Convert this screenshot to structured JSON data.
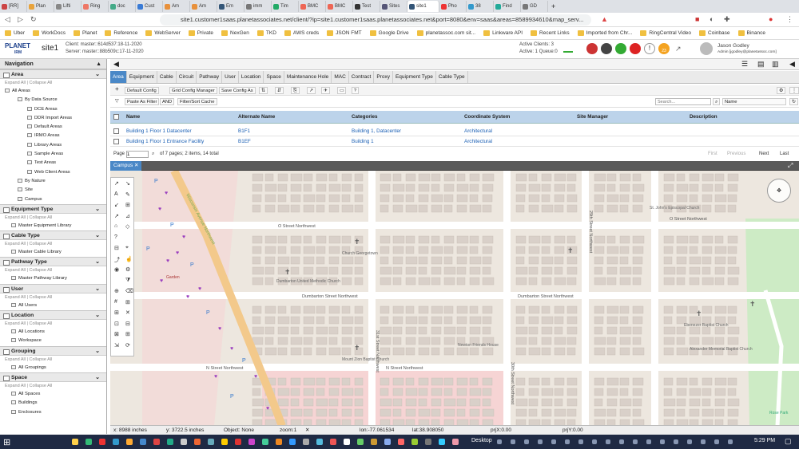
{
  "browser": {
    "tabs": [
      "[RR]",
      "Plan",
      "Lifti",
      "Ring",
      "doc",
      "Cust",
      "Am",
      "Am",
      "Em",
      "imm",
      "Tim",
      "BMC",
      "BMC",
      "Test",
      "Sites",
      "site1",
      "Pho",
      "38",
      "Find",
      "GD"
    ],
    "url": "site1.customer1saas.planetassociates.net/client/?ip=site1.customer1saas.planetassociates.net&port=8080&env=saas&areas=8589934610&map_serv...",
    "bookmarks": [
      "Uber",
      "WorkDocs",
      "Planet",
      "Reference",
      "WebServer",
      "Private",
      "NexGen",
      "TKD",
      "AWS creds",
      "JSON FMT",
      "Google Drive",
      "planetassoc.com sit...",
      "Linkware API",
      "Recent Links",
      "Imported from Chr...",
      "RingCentral Video",
      "Coinbase",
      "Binance"
    ]
  },
  "app": {
    "logo_line1": "PLANET",
    "logo_line2": "IRM",
    "site": "site1",
    "client_version": "Client: master::614d537:18-11-2020",
    "server_version": "Server: master::88b509c:17-11-2020",
    "active_clients": "Active Clients: 3",
    "active_queue": "Active: 1 Queue:0",
    "badge_count": "23",
    "user_name": "Jason Godley",
    "user_email": "Admin [jgodley@planetassoc.com]"
  },
  "nav": {
    "title": "Navigation",
    "expand_all": "Expand All",
    "collapse_all": "Collapse All",
    "area_title": "Area",
    "area_tree": [
      "All Areas",
      "By Data Source",
      "DCE Areas",
      "DDR Import Areas",
      "Default Areas",
      "IRMO Areas",
      "Library Areas",
      "Sample Areas",
      "Test Areas",
      "Web Client Areas",
      "By Nature",
      "Site",
      "Campus"
    ],
    "equipment_type_title": "Equipment Type",
    "equipment_type_item": "Master Equipment Library",
    "cable_type_title": "Cable Type",
    "cable_type_item": "Master Cable Library",
    "pathway_type_title": "Pathway Type",
    "pathway_type_item": "Master Pathway Library",
    "user_title": "User",
    "user_item": "All Users",
    "location_title": "Location",
    "location_items": [
      "All Locations",
      "Workspace"
    ],
    "grouping_title": "Grouping",
    "grouping_item": "All Groupings",
    "space_title": "Space",
    "space_items": [
      "All Spaces",
      "Buildings",
      "Enclosures"
    ]
  },
  "content": {
    "tabs": [
      "Area",
      "Equipment",
      "Cable",
      "Circuit",
      "Pathway",
      "User",
      "Location",
      "Space",
      "Maintenance Hole",
      "MAC",
      "Contract",
      "Proxy",
      "Equipment Type",
      "Cable Type"
    ],
    "toolbar": {
      "default_config": "Default Config",
      "grid_config": "Grid Config Manager",
      "save_config_as": "Save Config As"
    },
    "toolbar2": {
      "paste_filter": "Paste As Filter",
      "and": "AND",
      "filter_sort": "Filter/Sort Cache"
    },
    "search_placeholder": "Search...",
    "search_field": "Name",
    "columns": [
      "Name",
      "Alternate Name",
      "Categories",
      "Coordinate System",
      "Site Manager",
      "Description"
    ],
    "rows": [
      {
        "name": "Building 1 Floor 1 Datacenter",
        "alt": "B1F1",
        "categories": "Building 1, Datacenter",
        "coord": "Architectural"
      },
      {
        "name": "Building 1 Floor 1 Entrance Facility",
        "alt": "B1EF",
        "categories": "Building 1",
        "coord": "Architectural"
      }
    ],
    "pager": {
      "page_label": "Page",
      "page": "1",
      "of": "of 7 pages; 2 items, 14 total",
      "first": "First",
      "previous": "Previous",
      "next": "Next",
      "last": "Last"
    }
  },
  "map": {
    "tab": "Campus",
    "status_inactive": "MAC Status: Inactive",
    "streets": [
      "O Street Northwest",
      "Dumbarton Street Northwest",
      "N Street Northwest",
      "29th Street Northwest",
      "30th Street Northwest",
      "31st Street Northwest",
      "Wisconsin Avenue Northwest"
    ],
    "labels": [
      "Church Georgetown",
      "Dumbarton United Methodic Church",
      "Mount Zion Baptist Church",
      "Newton Friends House",
      "Ebenezer Baptist Church",
      "Alexander Memorial Baptist Church",
      "St. John's Episcopal Church",
      "Rose Park",
      "Garden"
    ],
    "colors": {
      "land": "#ede7df",
      "roads": "#ffffff",
      "buildings": "#d9d0c9",
      "main_road": "#f3c98b",
      "commercial": "#f6d4d4",
      "park": "#cdebc5"
    }
  },
  "status_bar": {
    "x": "x: 8988 inches",
    "y": "y: 3722.5 inches",
    "object": "Object: None",
    "zoom": "zoom:1",
    "lon": "lon:-77.061534",
    "lat": "lat:38.908050",
    "prjx": "prjX:0.00",
    "prjy": "prjY:0.00"
  },
  "taskbar": {
    "desktop": "Desktop",
    "time": "5:29 PM"
  }
}
